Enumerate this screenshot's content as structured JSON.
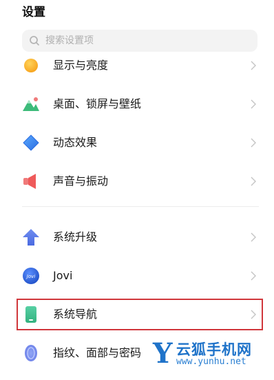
{
  "header": {
    "title": "设置"
  },
  "search": {
    "placeholder": "搜索设置项"
  },
  "items": [
    {
      "label": "显示与亮度",
      "icon": "sun-icon"
    },
    {
      "label": "桌面、锁屏与壁纸",
      "icon": "wallpaper-icon"
    },
    {
      "label": "动态效果",
      "icon": "diamond-icon"
    },
    {
      "label": "声音与振动",
      "icon": "speaker-icon"
    },
    {
      "label": "系统升级",
      "icon": "arrow-up-icon"
    },
    {
      "label": "Jovi",
      "icon": "jovi-icon"
    },
    {
      "label": "系统导航",
      "icon": "phone-icon"
    },
    {
      "label": "指纹、面部与密码",
      "icon": "fingerprint-icon"
    }
  ],
  "watermark": {
    "letter": "Y",
    "name": "云狐手机网",
    "url": "www.yunhu.net"
  },
  "colors": {
    "highlight": "#d0363b",
    "watermark": "#1f73c9"
  }
}
